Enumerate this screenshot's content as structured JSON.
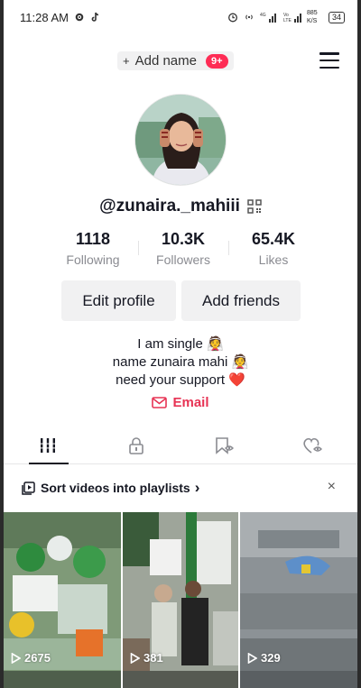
{
  "status_bar": {
    "time": "11:28 AM",
    "speed": "885 K/S",
    "battery": "34"
  },
  "top_nav": {
    "add_name_label": "Add name",
    "add_name_plus": "+",
    "badge": "9+"
  },
  "profile": {
    "username": "@zunaira._mahiii",
    "stats": [
      {
        "value": "1118",
        "label": "Following"
      },
      {
        "value": "10.3K",
        "label": "Followers"
      },
      {
        "value": "65.4K",
        "label": "Likes"
      }
    ],
    "buttons": {
      "edit": "Edit profile",
      "add_friends": "Add friends"
    },
    "bio": [
      "I am single 👰",
      "name zunaira mahi 👰",
      "need your support ❤️"
    ],
    "email_label": "Email"
  },
  "tabs": [
    {
      "icon": "grid-icon",
      "active": true
    },
    {
      "icon": "lock-icon",
      "active": false
    },
    {
      "icon": "bookmark-icon",
      "active": false
    },
    {
      "icon": "liked-heart-icon",
      "active": false
    }
  ],
  "playlist_banner": {
    "text": "Sort videos into playlists",
    "chevron": "›",
    "close": "×"
  },
  "videos": [
    {
      "views": "2675"
    },
    {
      "views": "381"
    },
    {
      "views": "329"
    }
  ],
  "colors": {
    "accent": "#fe2c55",
    "email": "#e73354",
    "text": "#161823",
    "muted": "#8a8b91",
    "button_bg": "#f1f1f2"
  }
}
